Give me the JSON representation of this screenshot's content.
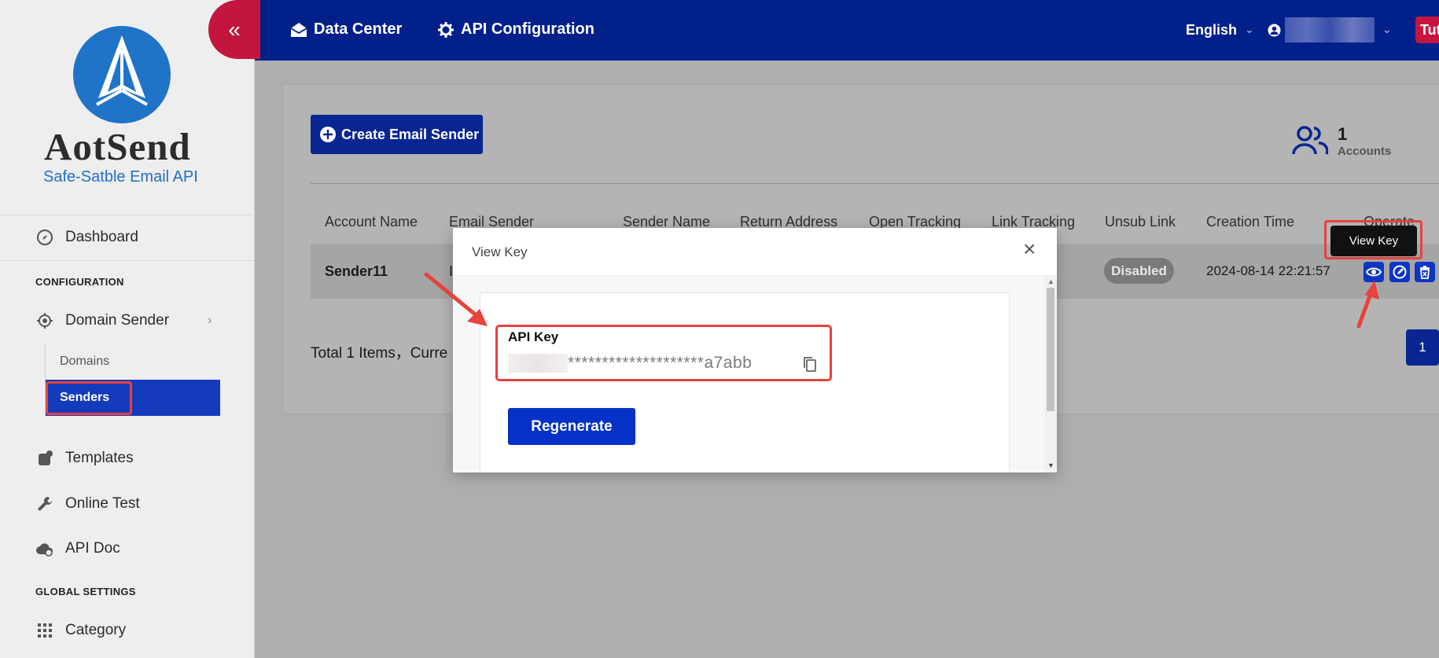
{
  "brand": {
    "name": "AotSend",
    "tagline": "Safe-Satble Email API"
  },
  "topbar": {
    "collapse_icon": "double-chevron-left-icon",
    "links": [
      {
        "label": "Data Center",
        "icon": "envelope-open-icon"
      },
      {
        "label": "API Configuration",
        "icon": "gear-icon"
      }
    ],
    "language": "English",
    "tutorial_label": "Tut"
  },
  "sidebar": {
    "dashboard": "Dashboard",
    "section_configuration": "CONFIGURATION",
    "domain_sender": "Domain Sender",
    "domains": "Domains",
    "senders": "Senders",
    "templates": "Templates",
    "online_test": "Online Test",
    "api_doc": "API Doc",
    "section_global": "GLOBAL SETTINGS",
    "category": "Category"
  },
  "main": {
    "create_button": "Create Email Sender",
    "accounts_count": "1",
    "accounts_label": "Accounts",
    "columns": [
      "Account Name",
      "Email Sender",
      "Sender Name",
      "Return Address",
      "Open Tracking",
      "Link Tracking",
      "Unsub Link",
      "Creation Time",
      "Operate"
    ],
    "row": {
      "account_name": "Sender11",
      "email_sender_partial": "I",
      "unsub_link": "Disabled",
      "creation_time": "2024-08-14 22:21:57"
    },
    "total_text": "Total 1 Items，Curre",
    "page": "1",
    "tooltip": "View Key"
  },
  "modal": {
    "title": "View Key",
    "close_symbol": "×",
    "api_key_label": "API Key",
    "api_key_value": "********************a7abb",
    "regenerate_label": "Regenerate"
  },
  "colors": {
    "topbar": "#012089",
    "accent_red": "#c4153f",
    "primary_button": "#082592",
    "highlight": "#e9413c"
  }
}
